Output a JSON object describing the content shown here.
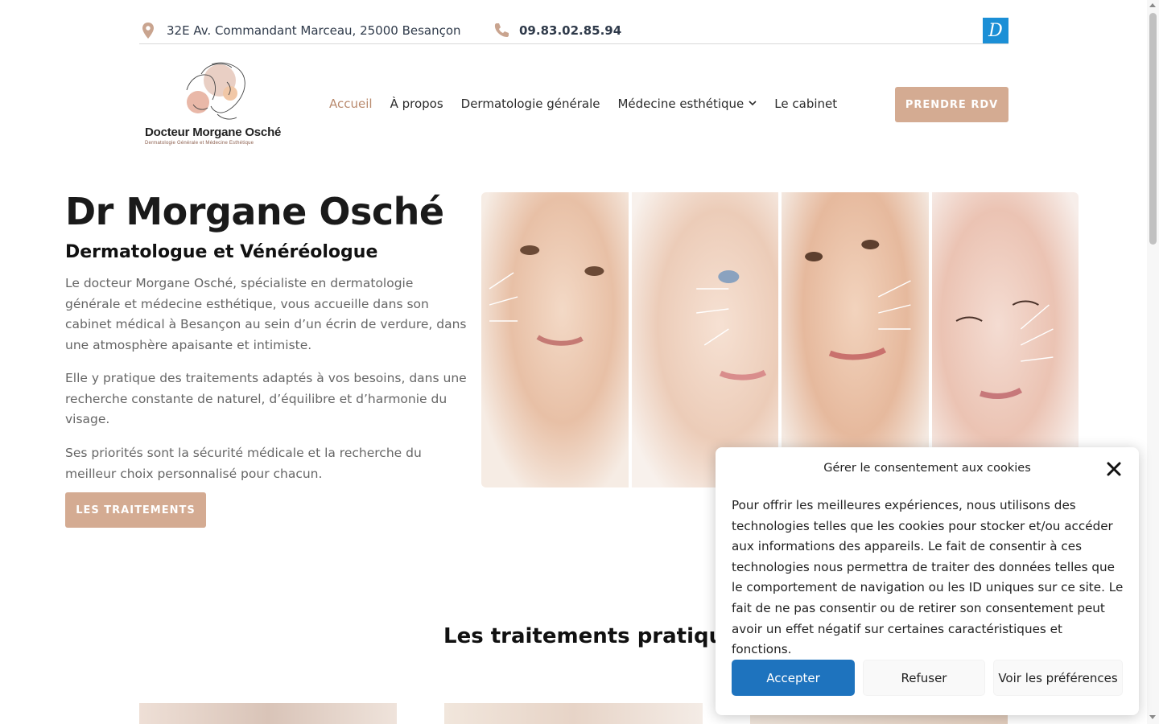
{
  "topbar": {
    "address": "32E Av. Commandant Marceau, 25000 Besançon",
    "phone": "09.83.02.85.94",
    "doctolib_letter": "D",
    "address_icon": "location-pin-icon",
    "phone_icon": "phone-icon"
  },
  "logo": {
    "name": "Docteur Morgane Osché",
    "tagline": "Dermatologie Générale et Médecine Esthétique"
  },
  "nav": {
    "items": [
      {
        "label": "Accueil",
        "active": true
      },
      {
        "label": "À propos"
      },
      {
        "label": "Dermatologie générale"
      },
      {
        "label": "Médecine esthétique",
        "has_dropdown": true
      },
      {
        "label": "Le cabinet"
      }
    ],
    "cta": "PRENDRE RDV"
  },
  "hero": {
    "title": "Dr Morgane Osché",
    "subtitle": "Dermatologue et Vénéréologue",
    "paragraphs": [
      "Le docteur Morgane Osché, spécialiste en dermatologie générale et médecine esthétique, vous accueille dans son cabinet médical à Besançon au sein d’un écrin de verdure, dans une atmosphère apaisante et intimiste.",
      "Elle y pratique des traitements adaptés à vos besoins, dans une recherche constante de naturel, d’équilibre et d’harmonie du visage.",
      "Ses priorités sont la sécurité médicale et la recherche du meilleur choix personnalisé pour chacun."
    ],
    "button": "LES TRAITEMENTS"
  },
  "treatments": {
    "title": "Les traitements pratiqués"
  },
  "cookie": {
    "title": "Gérer le consentement aux cookies",
    "body": "Pour offrir les meilleures expériences, nous utilisons des technologies telles que les cookies pour stocker et/ou accéder aux informations des appareils. Le fait de consentir à ces technologies nous permettra de traiter des données telles que le comportement de navigation ou les ID uniques sur ce site. Le fait de ne pas consentir ou de retirer son consentement peut avoir un effet négatif sur certaines caractéristiques et fonctions.",
    "accept": "Accepter",
    "refuse": "Refuser",
    "preferences": "Voir les préférences"
  },
  "colors": {
    "accent": "#d4ab92",
    "active_nav": "#b98a6e",
    "accept_blue": "#1e73be",
    "doctolib_blue": "#1b8fd6"
  }
}
